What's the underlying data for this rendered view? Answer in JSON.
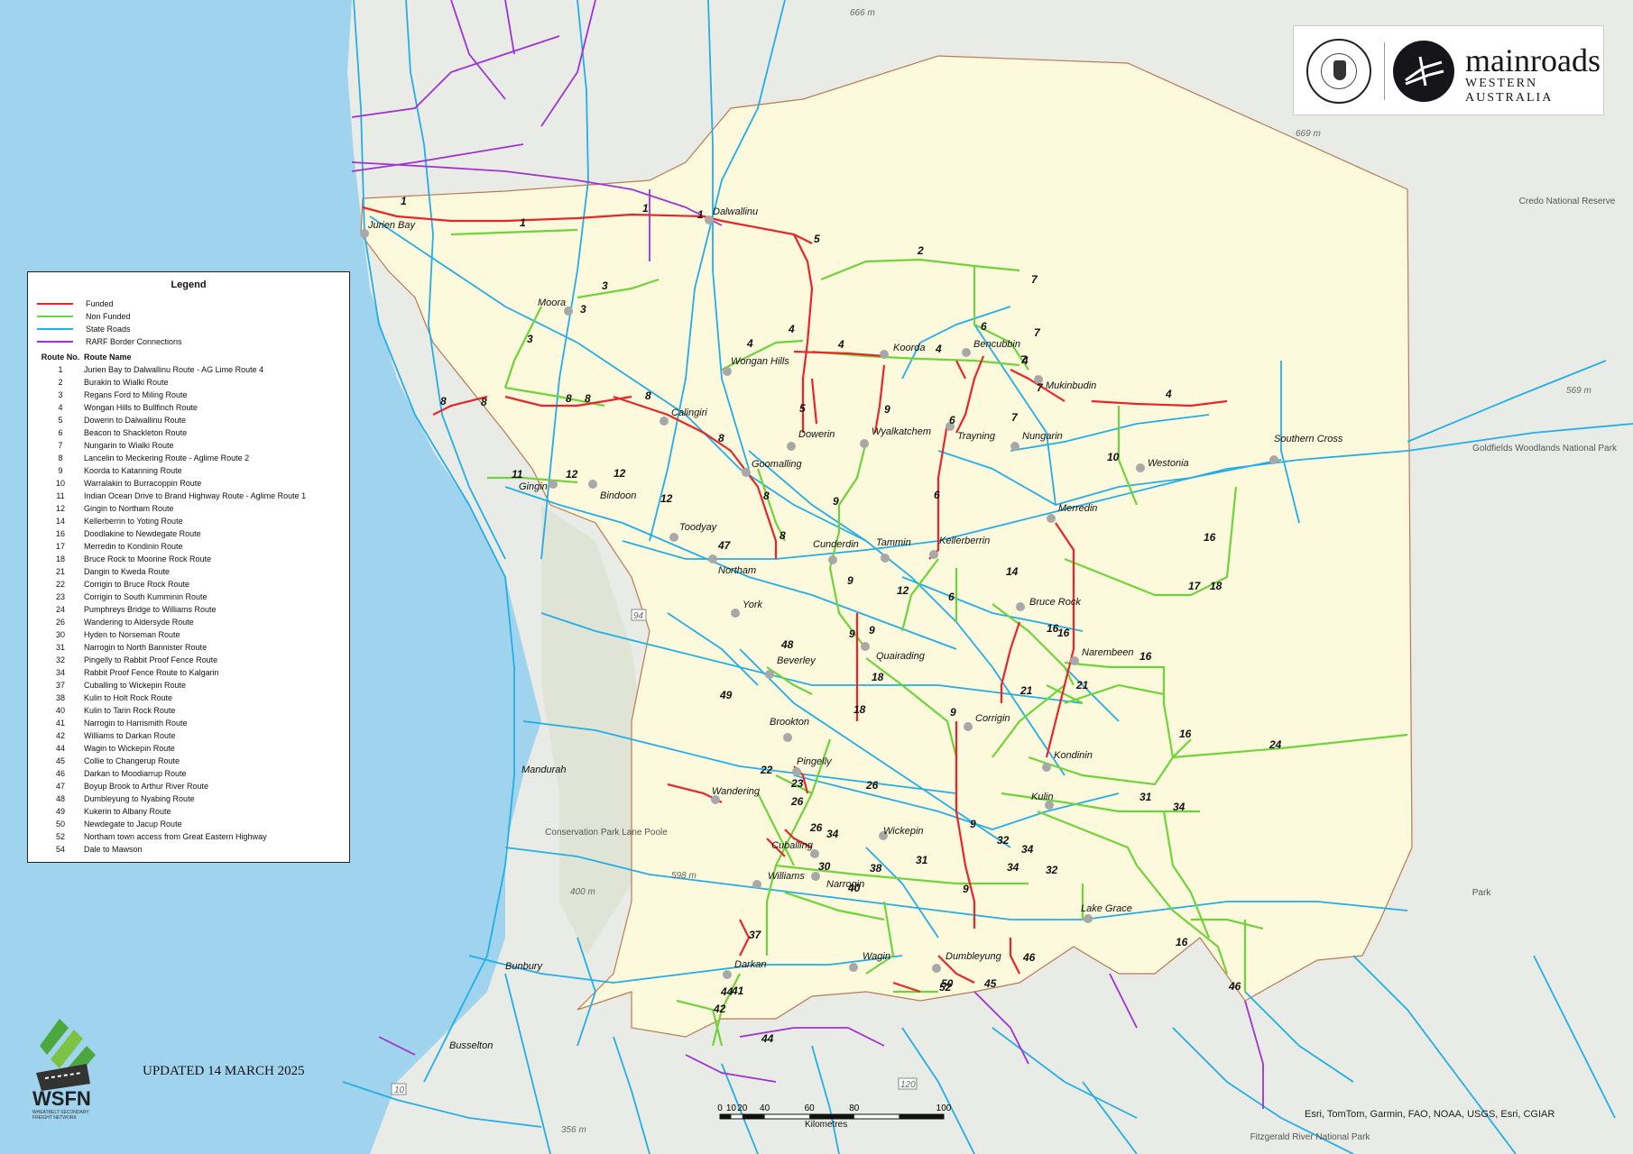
{
  "map": {
    "towns": [
      {
        "name": "Jurien Bay"
      },
      {
        "name": "Dalwallinu"
      },
      {
        "name": "Moora"
      },
      {
        "name": "Wongan Hills"
      },
      {
        "name": "Koorda"
      },
      {
        "name": "Bencubbin"
      },
      {
        "name": "Mukinbudin"
      },
      {
        "name": "Calingiri"
      },
      {
        "name": "Dowerin"
      },
      {
        "name": "Wyalkatchem"
      },
      {
        "name": "Trayning"
      },
      {
        "name": "Nungarin"
      },
      {
        "name": "Goomalling"
      },
      {
        "name": "Westonia"
      },
      {
        "name": "Southern Cross"
      },
      {
        "name": "Gingin"
      },
      {
        "name": "Bindoon"
      },
      {
        "name": "Toodyay"
      },
      {
        "name": "Merredin"
      },
      {
        "name": "Northam"
      },
      {
        "name": "Cunderdin"
      },
      {
        "name": "Tammin"
      },
      {
        "name": "Kellerberrin"
      },
      {
        "name": "York"
      },
      {
        "name": "Bruce Rock"
      },
      {
        "name": "Narembeen"
      },
      {
        "name": "Beverley"
      },
      {
        "name": "Quairading"
      },
      {
        "name": "Corrigin"
      },
      {
        "name": "Brookton"
      },
      {
        "name": "Kondinin"
      },
      {
        "name": "Pingelly"
      },
      {
        "name": "Kulin"
      },
      {
        "name": "Wandering"
      },
      {
        "name": "Wickepin"
      },
      {
        "name": "Cuballing"
      },
      {
        "name": "Williams"
      },
      {
        "name": "Narrogin"
      },
      {
        "name": "Lake Grace"
      },
      {
        "name": "Darkan"
      },
      {
        "name": "Wagin"
      },
      {
        "name": "Dumbleyung"
      }
    ],
    "places": [
      "Mandurah",
      "Bunbury",
      "Busselton"
    ],
    "parks": [
      "Conservation Park Lane Poole",
      "Credo National Reserve",
      "Goldfields Woodlands National Park",
      "Fitzgerald River National Park",
      "Park"
    ],
    "elevations": [
      "666 m",
      "669 m",
      "569 m",
      "598 m",
      "400 m",
      "356 m"
    ],
    "highway_shields": [
      "94",
      "10",
      "120"
    ],
    "route_labels": [
      "1",
      "1",
      "1",
      "1",
      "2",
      "3",
      "3",
      "3",
      "4",
      "4",
      "4",
      "4",
      "4",
      "4",
      "5",
      "5",
      "6",
      "6",
      "6",
      "6",
      "7",
      "7",
      "7",
      "7",
      "7",
      "8",
      "8",
      "8",
      "8",
      "8",
      "8",
      "8",
      "8",
      "9",
      "9",
      "9",
      "9",
      "9",
      "9",
      "9",
      "9",
      "10",
      "11",
      "12",
      "12",
      "12",
      "12",
      "14",
      "16",
      "16",
      "16",
      "16",
      "16",
      "16",
      "17",
      "18",
      "18",
      "18",
      "21",
      "21",
      "22",
      "23",
      "24",
      "26",
      "26",
      "26",
      "30",
      "31",
      "31",
      "32",
      "32",
      "34",
      "34",
      "34",
      "34",
      "37",
      "38",
      "40",
      "41",
      "42",
      "44",
      "44",
      "45",
      "46",
      "46",
      "47",
      "48",
      "49",
      "50",
      "52",
      "54",
      "54"
    ]
  },
  "colors": {
    "funded": "#e8262a",
    "non_funded": "#6fd43a",
    "state_roads": "#22aee6",
    "rarf": "#a032d4",
    "region_fill": "#fcf9dc",
    "region_border": "#b97a57",
    "ocean": "#9fd3ee"
  },
  "legend": {
    "title": "Legend",
    "symbols": [
      {
        "label": "Funded",
        "color": "#e8262a"
      },
      {
        "label": "Non Funded",
        "color": "#6fd43a"
      },
      {
        "label": "State Roads",
        "color": "#22aee6"
      },
      {
        "label": "RARF Border Connections",
        "color": "#a032d4"
      }
    ],
    "col_route_no": "Route No.",
    "col_route_name": "Route Name",
    "routes": [
      {
        "no": "1",
        "name": "Jurien Bay to Dalwallinu Route - AG Lime Route 4"
      },
      {
        "no": "2",
        "name": "Burakin to Wialki Route"
      },
      {
        "no": "3",
        "name": "Regans Ford to Miling Route"
      },
      {
        "no": "4",
        "name": "Wongan Hills to Bullfinch Route"
      },
      {
        "no": "5",
        "name": "Dowerin to Dalwallinu Route"
      },
      {
        "no": "6",
        "name": "Beacon to Shackleton Route"
      },
      {
        "no": "7",
        "name": "Nungarin to Wialki Route"
      },
      {
        "no": "8",
        "name": "Lancelin to Meckering Route - Aglime Route 2"
      },
      {
        "no": "9",
        "name": "Koorda to Katanning Route"
      },
      {
        "no": "10",
        "name": "Warralakin to Burracoppin Route"
      },
      {
        "no": "11",
        "name": "Indian Ocean Drive to Brand Highway Route - Aglime Route 1"
      },
      {
        "no": "12",
        "name": "Gingin to Northam Route"
      },
      {
        "no": "14",
        "name": "Kellerberrin to Yoting Route"
      },
      {
        "no": "16",
        "name": "Doodlakine to Newdegate Route"
      },
      {
        "no": "17",
        "name": "Merredin to Kondinin Route"
      },
      {
        "no": "18",
        "name": "Bruce Rock to Moorine Rock Route"
      },
      {
        "no": "21",
        "name": "Dangin to Kweda Route"
      },
      {
        "no": "22",
        "name": "Corrigin to Bruce Rock Route"
      },
      {
        "no": "23",
        "name": "Corrigin to South Kumminin Route"
      },
      {
        "no": "24",
        "name": "Pumphreys Bridge to Williams Route"
      },
      {
        "no": "26",
        "name": "Wandering to Aldersyde Route"
      },
      {
        "no": "30",
        "name": "Hyden to Norseman Route"
      },
      {
        "no": "31",
        "name": "Narrogin to North Bannister Route"
      },
      {
        "no": "32",
        "name": "Pingelly to Rabbit Proof Fence Route"
      },
      {
        "no": "34",
        "name": "Rabbit Proof Fence Route to Kalgarin"
      },
      {
        "no": "37",
        "name": "Cuballing to Wickepin Route"
      },
      {
        "no": "38",
        "name": "Kulin to Holt Rock Route"
      },
      {
        "no": "40",
        "name": "Kulin to Tarin Rock Route"
      },
      {
        "no": "41",
        "name": "Narrogin to Harrismith Route"
      },
      {
        "no": "42",
        "name": "Williams to Darkan Route"
      },
      {
        "no": "44",
        "name": "Wagin to Wickepin Route"
      },
      {
        "no": "45",
        "name": "Collie to Changerup Route"
      },
      {
        "no": "46",
        "name": "Darkan to Moodiarrup Route"
      },
      {
        "no": "47",
        "name": "Boyup Brook to Arthur River Route"
      },
      {
        "no": "48",
        "name": "Dumbleyung to Nyabing Route"
      },
      {
        "no": "49",
        "name": "Kukerin to Albany Route"
      },
      {
        "no": "50",
        "name": "Newdegate to Jacup Route"
      },
      {
        "no": "52",
        "name": "Northam town access from Great Eastern Highway"
      },
      {
        "no": "54",
        "name": "Dale to Mawson"
      }
    ]
  },
  "header": {
    "seal_name": "THE GOVERNMENT OF WESTERN AUSTRALIA",
    "brand_name": "mainroads",
    "brand_sub": "WESTERN AUSTRALIA"
  },
  "footer": {
    "updated": "UPDATED 14 MARCH 2025",
    "wsfn": "WSFN",
    "wsfn_sub": "WHEATBELT SECONDARY FREIGHT NETWORK",
    "scale_ticks": [
      "0",
      "10",
      "20",
      "40",
      "60",
      "80",
      "100"
    ],
    "scale_unit": "Kilometres",
    "attribution": "Esri, TomTom, Garmin, FAO, NOAA, USGS, Esri, CGIAR"
  }
}
